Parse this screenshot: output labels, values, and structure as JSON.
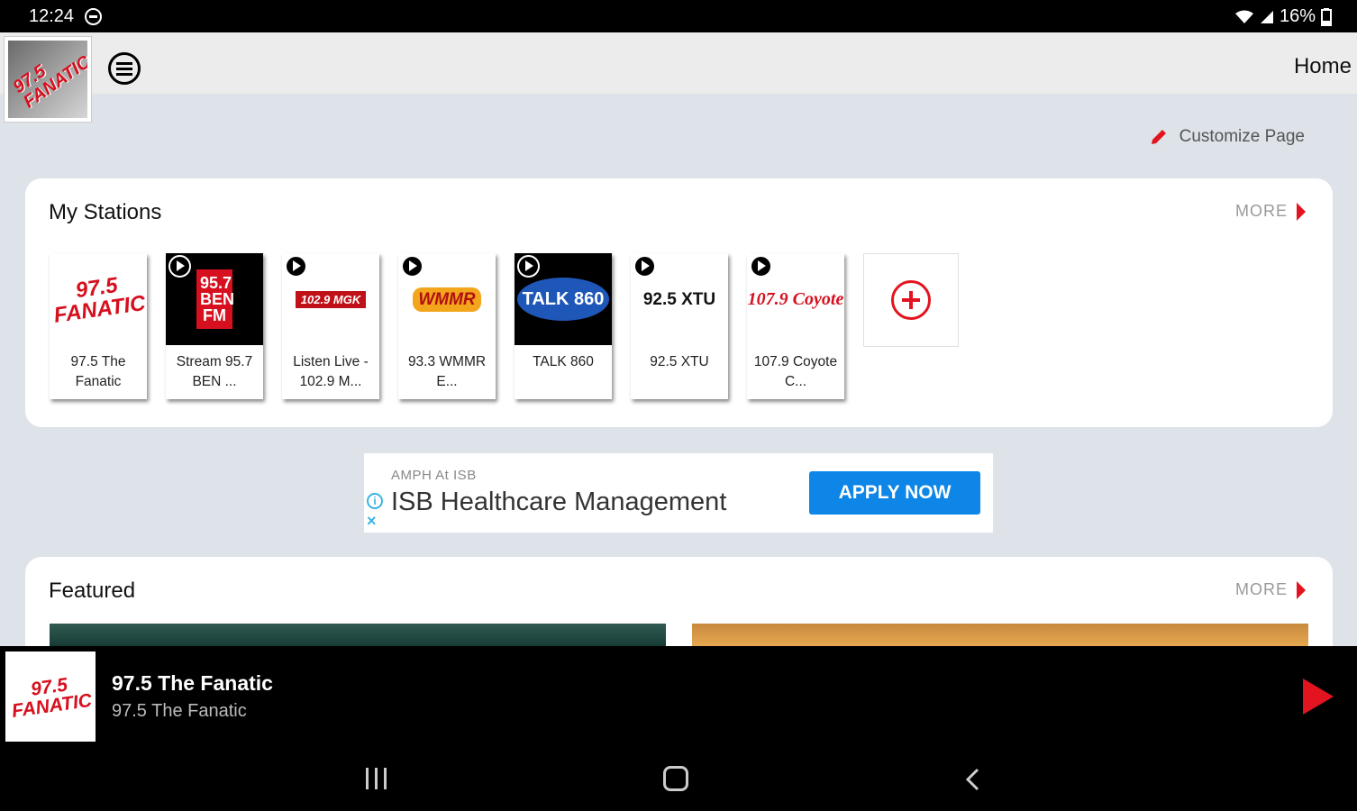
{
  "status_bar": {
    "time": "12:24",
    "battery": "16%"
  },
  "header": {
    "logo_text": "97.5 FANATIC",
    "title": "Home"
  },
  "customize": {
    "label": "Customize Page",
    "icon": "pencil-icon"
  },
  "my_stations": {
    "title": "My Stations",
    "more_label": "MORE",
    "stations": [
      {
        "label": "97.5 The Fanatic",
        "art": "97.5 FANATIC"
      },
      {
        "label": "Stream 95.7 BEN ...",
        "art": "95.7 BEN FM"
      },
      {
        "label": "Listen Live - 102.9 M...",
        "art": "102.9 MGK"
      },
      {
        "label": "93.3 WMMR E...",
        "art": "WMMR"
      },
      {
        "label": "TALK 860",
        "art": "TALK 860"
      },
      {
        "label": "92.5 XTU",
        "art": "92.5 XTU"
      },
      {
        "label": "107.9 Coyote C...",
        "art": "107.9 Coyote"
      }
    ],
    "add_icon": "add-circle-icon"
  },
  "ad": {
    "sponsor": "AMPH At ISB",
    "headline": "ISB Healthcare Management",
    "cta": "APPLY NOW"
  },
  "featured": {
    "title": "Featured",
    "more_label": "MORE"
  },
  "player": {
    "thumb_text": "97.5 FANATIC",
    "title": "97.5 The Fanatic",
    "subtitle": "97.5 The Fanatic"
  },
  "colors": {
    "accent": "#e3141f",
    "cta_blue": "#0d86e8",
    "background": "#dde3e8"
  }
}
